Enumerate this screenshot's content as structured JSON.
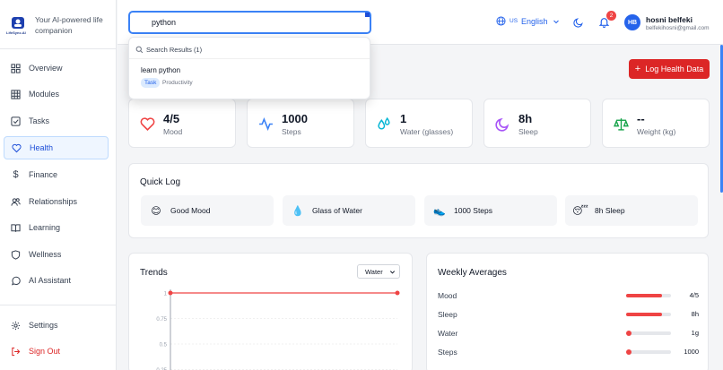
{
  "brand": {
    "logo_text": "LifeSync.AI",
    "tagline": "Your AI-powered life companion"
  },
  "sidebar": {
    "items": [
      {
        "label": "Overview",
        "icon": "grid-icon"
      },
      {
        "label": "Modules",
        "icon": "table-icon"
      },
      {
        "label": "Tasks",
        "icon": "checkbox-icon"
      },
      {
        "label": "Health",
        "icon": "heart-icon",
        "active": true
      },
      {
        "label": "Finance",
        "icon": "dollar-icon"
      },
      {
        "label": "Relationships",
        "icon": "users-icon"
      },
      {
        "label": "Learning",
        "icon": "book-icon"
      },
      {
        "label": "Wellness",
        "icon": "shield-icon"
      },
      {
        "label": "AI Assistant",
        "icon": "chat-icon"
      }
    ],
    "settings": "Settings",
    "signout": "Sign Out"
  },
  "header": {
    "search_value": "python",
    "lang_code": "US",
    "lang": "English",
    "notification_count": "2",
    "avatar_initials": "HB",
    "user_name": "hosni belfeki",
    "user_email": "belfekihosni@gmail.com"
  },
  "search_results": {
    "heading": "Search Results (1)",
    "items": [
      {
        "title": "learn python",
        "tag": "Task",
        "category": "Productivity"
      }
    ]
  },
  "main": {
    "log_button": "Log Health Data",
    "stats": [
      {
        "value": "4/5",
        "label": "Mood",
        "icon": "heart-icon",
        "color": "#ef4444"
      },
      {
        "value": "1000",
        "label": "Steps",
        "icon": "activity-icon",
        "color": "#3b82f6"
      },
      {
        "value": "1",
        "label": "Water (glasses)",
        "icon": "droplets-icon",
        "color": "#06b6d4"
      },
      {
        "value": "8h",
        "label": "Sleep",
        "icon": "moon-icon",
        "color": "#a855f7"
      },
      {
        "value": "--",
        "label": "Weight (kg)",
        "icon": "scale-icon",
        "color": "#16a34a"
      }
    ],
    "quick_log": {
      "title": "Quick Log",
      "items": [
        {
          "label": "Good Mood",
          "emoji": "😊"
        },
        {
          "label": "Glass of Water",
          "emoji": "💧"
        },
        {
          "label": "1000 Steps",
          "emoji": "👟"
        },
        {
          "label": "8h Sleep",
          "emoji": "😴"
        }
      ]
    },
    "trends": {
      "title": "Trends",
      "select_value": "Water"
    },
    "weekly": {
      "title": "Weekly Averages",
      "rows": [
        {
          "label": "Mood",
          "value": "4/5",
          "fraction": 0.8
        },
        {
          "label": "Sleep",
          "value": "8h",
          "fraction": 0.8
        },
        {
          "label": "Water",
          "value": "1g",
          "fraction": 0.02
        },
        {
          "label": "Steps",
          "value": "1000",
          "fraction": 0.02
        }
      ]
    }
  },
  "chart_data": {
    "type": "line",
    "y_ticks": [
      "1",
      "0.75",
      "0.5",
      "0.25"
    ],
    "ylim": [
      0.25,
      1
    ],
    "series": [
      {
        "values": [
          1,
          1
        ]
      }
    ],
    "color": "#ef4444"
  }
}
